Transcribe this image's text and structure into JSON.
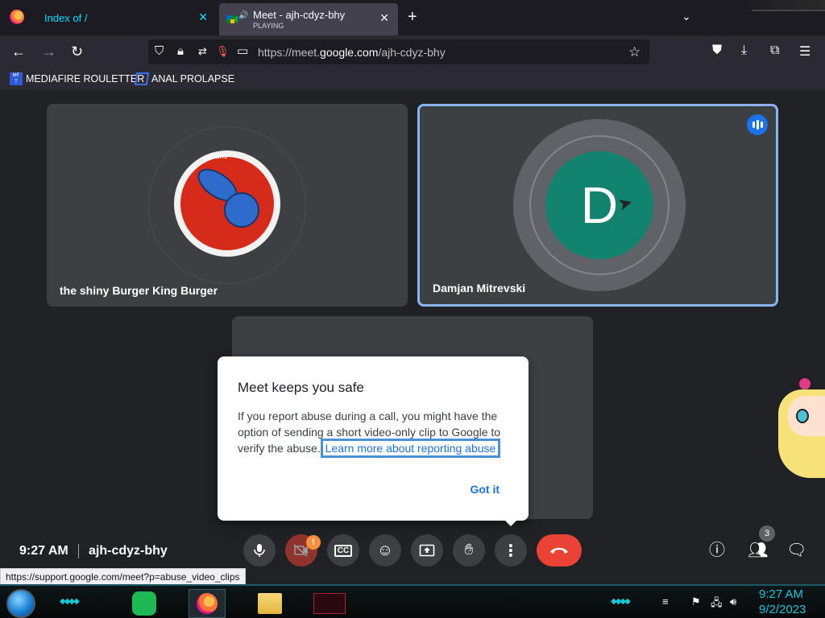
{
  "browser": {
    "tabs": [
      {
        "title": "Index of /"
      },
      {
        "title": "Meet - ajh-cdyz-bhy",
        "subtitle": "PLAYING"
      }
    ],
    "url": {
      "prefix": "https://meet.",
      "host": "google.com",
      "path": "/ajh-cdyz-bhy"
    },
    "bookmarks": [
      {
        "label": "MEDIAFIRE ROULETTER",
        "icon": "mediafire-icon"
      },
      {
        "label": "ANAL PROLAPSE",
        "icon": "bookmark-sigma-icon"
      }
    ],
    "status_url": "https://support.google.com/meet?p=abuse_video_clips"
  },
  "meet": {
    "participants": [
      {
        "name": "the shiny Burger King Burger",
        "avatar_text": "scriptions"
      },
      {
        "name": "Damjan Mitrevski",
        "initial": "D",
        "avatar_color": "#11836f",
        "speaking": true
      }
    ],
    "dialog": {
      "title": "Meet keeps you safe",
      "body": "If you report abuse during a call, you might have the option of sending a short video-only clip to Google to verify the abuse.",
      "link": "Learn more about reporting abuse",
      "button": "Got it"
    },
    "controls": {
      "time": "9:27 AM",
      "meeting_code": "ajh-cdyz-bhy",
      "camera_badge": "!",
      "people_count": "3"
    }
  },
  "taskbar": {
    "time": "9:27 AM",
    "date": "9/2/2023"
  },
  "colors": {
    "accent_blue": "#1a73e8",
    "end_call_red": "#ea4335",
    "avatar_teal": "#11836f",
    "taskbar_cyan": "#15c8d8"
  }
}
